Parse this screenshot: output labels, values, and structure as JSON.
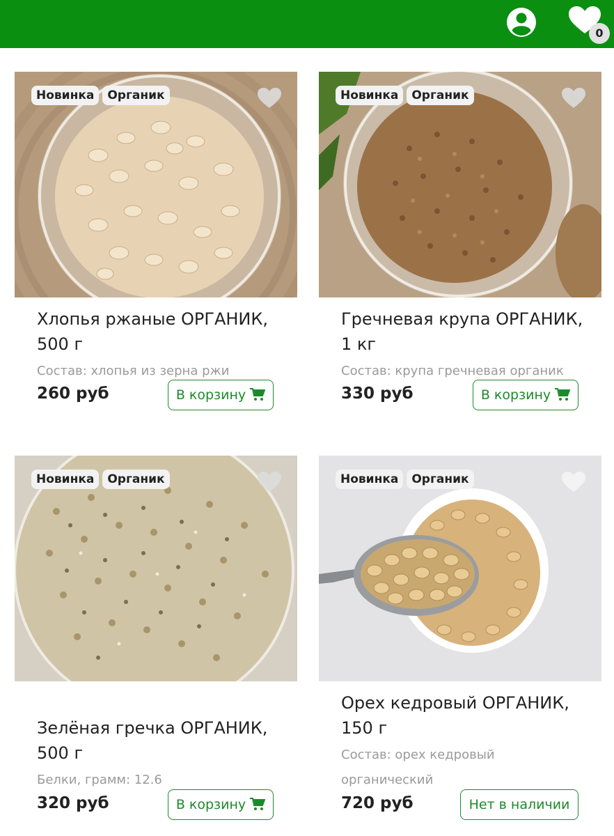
{
  "header": {
    "favorites_count": "0",
    "accent": "#0a8f10"
  },
  "products": [
    {
      "tags": [
        "Новинка",
        "Органик"
      ],
      "title_l1": "Хлопья ржаные ОРГАНИК,",
      "title_l2": "500 г",
      "desc_l1": "Состав: хлопья из зерна ржи",
      "desc_l2": "",
      "price": "260 руб",
      "button": "В корзину",
      "available": true
    },
    {
      "tags": [
        "Новинка",
        "Органик"
      ],
      "title_l1": "Гречневая крупа ОРГАНИК,",
      "title_l2": "1 кг",
      "desc_l1": "Состав: крупа гречневая органик",
      "desc_l2": "",
      "price": "330 руб",
      "button": "В корзину",
      "available": true
    },
    {
      "tags": [
        "Новинка",
        "Органик"
      ],
      "title_l1": "Зелёная гречка ОРГАНИК,",
      "title_l2": "500 г",
      "desc_l1": "Белки, грамм: 12.6",
      "desc_l2": "",
      "price": "320 руб",
      "button": "В корзину",
      "available": true
    },
    {
      "tags": [
        "Новинка",
        "Органик"
      ],
      "title_l1": "Орех кедровый ОРГАНИК,",
      "title_l2": "150 г",
      "desc_l1": "Состав: орех кедровый",
      "desc_l2": "органический",
      "price": "720 руб",
      "button": "Нет в наличии",
      "available": false
    }
  ]
}
